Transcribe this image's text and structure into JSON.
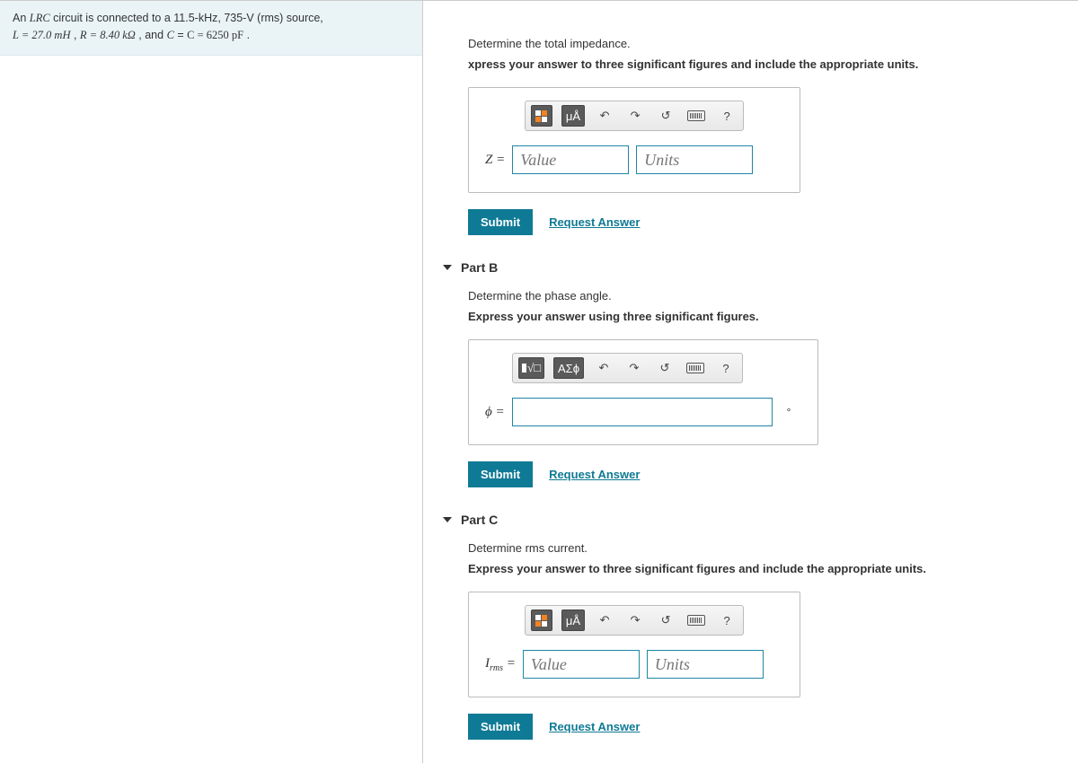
{
  "problem": {
    "line1_pre": "An ",
    "line1_var": "LRC",
    "line1_mid": " circuit is connected to a ",
    "freq": "11.5-kHz",
    "volt": "735-V",
    "rms": " (rms) source,",
    "line2_L": "L = 27.0  mH",
    "line2_R": "R = 8.40  kΩ",
    "line2_C": "C = 6250  pF"
  },
  "partA": {
    "prompt": "Determine the total impedance.",
    "hint": "xpress your answer to three significant figures and include the appropriate units.",
    "var": "Z =",
    "value_ph": "Value",
    "units_ph": "Units",
    "submit": "Submit",
    "request": "Request Answer",
    "tb_units": "μÅ",
    "tb_help": "?"
  },
  "partB": {
    "title": "Part B",
    "prompt": "Determine the phase angle.",
    "hint": "Express your answer using three significant figures.",
    "var": "ϕ =",
    "deg": "°",
    "submit": "Submit",
    "request": "Request Answer",
    "tb_sym": "ΑΣϕ",
    "tb_help": "?"
  },
  "partC": {
    "title": "Part C",
    "prompt": "Determine rms current.",
    "hint": "Express your answer to three significant figures and include the appropriate units.",
    "var": "Iᵣₘₛ =",
    "value_ph": "Value",
    "units_ph": "Units",
    "submit": "Submit",
    "request": "Request Answer",
    "tb_units": "μÅ",
    "tb_help": "?"
  }
}
